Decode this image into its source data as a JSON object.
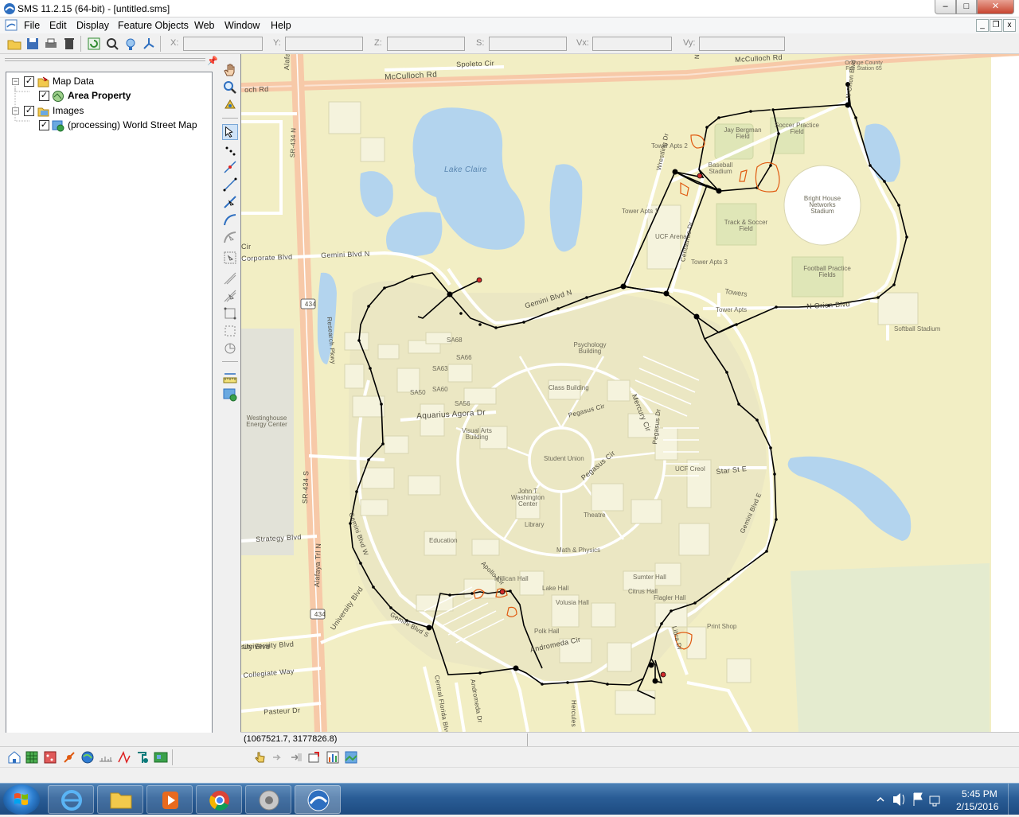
{
  "window": {
    "title": "SMS 11.2.15 (64-bit) - [untitled.sms]",
    "controls": {
      "minimize": "–",
      "maximize": "□",
      "close": "✕"
    }
  },
  "menu": {
    "items": [
      "File",
      "Edit",
      "Display",
      "Feature Objects",
      "Web",
      "Window",
      "Help"
    ],
    "mdi": {
      "minimize": "_",
      "restore": "❐",
      "close": "x"
    }
  },
  "toolbar": {
    "coords": [
      {
        "label": "X:",
        "value": ""
      },
      {
        "label": "Y:",
        "value": ""
      },
      {
        "label": "Z:",
        "value": ""
      },
      {
        "label": "S:",
        "value": ""
      },
      {
        "label": "Vx:",
        "value": ""
      },
      {
        "label": "Vy:",
        "value": ""
      }
    ]
  },
  "tree": {
    "items": [
      {
        "label": "Map Data",
        "checked": true,
        "expanded": true,
        "icon": "map-data-icon"
      },
      {
        "label": "Area Property",
        "checked": true,
        "bold": true,
        "icon": "area-property-icon"
      },
      {
        "label": "Images",
        "checked": true,
        "expanded": true,
        "icon": "images-folder-icon"
      },
      {
        "label": "(processing) World Street Map",
        "checked": true,
        "icon": "web-map-icon"
      }
    ]
  },
  "map": {
    "colors": {
      "land": "#f2eec4",
      "campus": "#e9e6be",
      "water": "#b3d4ee",
      "road": "#ffffff",
      "major_road": "#f7c9a8",
      "feature_arc": "#000000",
      "node_red": "#d22b2b",
      "polygon": "#e05a10",
      "park": "#dfe6b7"
    },
    "labels": [
      {
        "text": "McCulloch Rd",
        "kind": "road"
      },
      {
        "text": "Spoleto Cir",
        "kind": "road"
      },
      {
        "text": "McCulloch Rd",
        "kind": "road"
      },
      {
        "text": "Orange County Fire Station 65",
        "kind": "place"
      },
      {
        "text": "Lake Claire",
        "kind": "water"
      },
      {
        "text": "Jay Bergman Field",
        "kind": "place"
      },
      {
        "text": "Soccer Practice Field",
        "kind": "place"
      },
      {
        "text": "Tower Apts 2",
        "kind": "place"
      },
      {
        "text": "Baseball Stadium",
        "kind": "place"
      },
      {
        "text": "Bright House Networks Stadium",
        "kind": "place"
      },
      {
        "text": "Tower Apts 1",
        "kind": "place"
      },
      {
        "text": "Track & Soccer Field",
        "kind": "place"
      },
      {
        "text": "UCF Arena",
        "kind": "place"
      },
      {
        "text": "Tower Apts 3",
        "kind": "place"
      },
      {
        "text": "Football Practice Fields",
        "kind": "place"
      },
      {
        "text": "Towers",
        "kind": "place"
      },
      {
        "text": "Tower Apts",
        "kind": "place"
      },
      {
        "text": "N Orion Blvd",
        "kind": "road"
      },
      {
        "text": "Softball Stadium",
        "kind": "place"
      },
      {
        "text": "Gemini Blvd N",
        "kind": "road"
      },
      {
        "text": "Gemini Blvd N",
        "kind": "road"
      },
      {
        "text": "Corporate Blvd",
        "kind": "road"
      },
      {
        "text": "Psychology Building",
        "kind": "place"
      },
      {
        "text": "SA68",
        "kind": "place"
      },
      {
        "text": "SA66",
        "kind": "place"
      },
      {
        "text": "SA63",
        "kind": "place"
      },
      {
        "text": "SA60",
        "kind": "place"
      },
      {
        "text": "SA50",
        "kind": "place"
      },
      {
        "text": "SA56",
        "kind": "place"
      },
      {
        "text": "Class Building",
        "kind": "place"
      },
      {
        "text": "Mercury Cir",
        "kind": "road"
      },
      {
        "text": "Aquarius Agora Dr",
        "kind": "road"
      },
      {
        "text": "Pegasus Cir",
        "kind": "road"
      },
      {
        "text": "Visual Arts Building",
        "kind": "place"
      },
      {
        "text": "Pegasus Dr",
        "kind": "road"
      },
      {
        "text": "Student Union",
        "kind": "place"
      },
      {
        "text": "UCF Creol",
        "kind": "place"
      },
      {
        "text": "Star St E",
        "kind": "road"
      },
      {
        "text": "Pegasus Cir",
        "kind": "road"
      },
      {
        "text": "John T Washington Center",
        "kind": "place"
      },
      {
        "text": "Theatre",
        "kind": "place"
      },
      {
        "text": "Library",
        "kind": "place"
      },
      {
        "text": "Education",
        "kind": "place"
      },
      {
        "text": "Math & Physics",
        "kind": "place"
      },
      {
        "text": "Apollo Cir",
        "kind": "road"
      },
      {
        "text": "Millican Hall",
        "kind": "place"
      },
      {
        "text": "Lake Hall",
        "kind": "place"
      },
      {
        "text": "Volusia Hall",
        "kind": "place"
      },
      {
        "text": "Sumter Hall",
        "kind": "place"
      },
      {
        "text": "Citrus Hall",
        "kind": "place"
      },
      {
        "text": "Flagler Hall",
        "kind": "place"
      },
      {
        "text": "Polk Hall",
        "kind": "place"
      },
      {
        "text": "Andromeda Cir",
        "kind": "road"
      },
      {
        "text": "Gemini Blvd E",
        "kind": "road"
      },
      {
        "text": "Libra Dr",
        "kind": "road"
      },
      {
        "text": "Print Shop",
        "kind": "place"
      },
      {
        "text": "Gemini Blvd W",
        "kind": "road"
      },
      {
        "text": "Gemini Blvd S",
        "kind": "road"
      },
      {
        "text": "Westinghouse Energy Center",
        "kind": "place"
      },
      {
        "text": "Strategy Blvd",
        "kind": "road"
      },
      {
        "text": "University Blvd",
        "kind": "road"
      },
      {
        "text": "University Blvd",
        "kind": "road"
      },
      {
        "text": "Collegiate Way",
        "kind": "road"
      },
      {
        "text": "Pasteur Dr",
        "kind": "road"
      },
      {
        "text": "Central Florida Blvd",
        "kind": "road"
      },
      {
        "text": "Andromeda Dr",
        "kind": "road"
      },
      {
        "text": "Hercules",
        "kind": "road"
      },
      {
        "text": "Alafaya Trl N",
        "kind": "road"
      },
      {
        "text": "SR-434 N",
        "kind": "road"
      },
      {
        "text": "SR-434 S",
        "kind": "road"
      },
      {
        "text": "Alafaya Trl N",
        "kind": "road"
      },
      {
        "text": "434",
        "kind": "shield"
      },
      {
        "text": "434",
        "kind": "shield"
      },
      {
        "text": "Research Pkwy",
        "kind": "road"
      },
      {
        "text": "N Orion Blvd",
        "kind": "road"
      },
      {
        "text": "Wrestling Dr",
        "kind": "road"
      },
      {
        "text": "Centaurus Dr",
        "kind": "road"
      },
      {
        "text": "Cir",
        "kind": "road"
      },
      {
        "text": "och Rd",
        "kind": "road"
      },
      {
        "text": "sity Blvd",
        "kind": "road"
      },
      {
        "text": "N",
        "kind": "road"
      }
    ]
  },
  "status": {
    "cursor_coords": "(1067521.7, 3177826.8)"
  },
  "taskbar": {
    "apps": [
      "internet-explorer",
      "file-explorer",
      "media-player",
      "chrome",
      "speaker-app",
      "sms-app"
    ],
    "time": "5:45 PM",
    "date": "2/15/2016"
  }
}
